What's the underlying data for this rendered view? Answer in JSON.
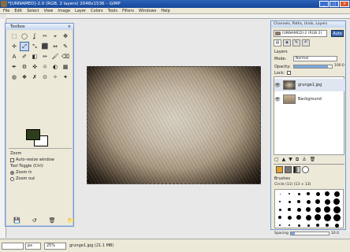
{
  "window": {
    "title": "*[UNNAMED]-2.0 (RGB, 2 layers) 2048x1536 – GIMP",
    "controls": [
      "_",
      "□",
      "×"
    ]
  },
  "menu": [
    "File",
    "Edit",
    "Select",
    "View",
    "Image",
    "Layer",
    "Colors",
    "Tools",
    "Filters",
    "Windows",
    "Help"
  ],
  "toolbox": {
    "title": "Toolbox",
    "tools": [
      "⬚",
      "◯",
      "ʆ",
      "✂",
      "⌖",
      "✥",
      "✛",
      "⤢",
      "⤡",
      "⬛",
      "⇔",
      "✎",
      "A",
      "✐",
      "◧",
      "✏",
      "🖌",
      "⌫",
      "✒",
      "⚙",
      "✜",
      "☼",
      "◐",
      "▦",
      "◍",
      "❖",
      "✗",
      "⊙",
      "✧",
      "✦"
    ],
    "active_tool_index": 7,
    "fg_color": "#2e3e1c",
    "bg_color": "#ffffff",
    "options": {
      "heading": "Zoom",
      "auto_resize": "Auto-resize window",
      "toggle_label": "Tool Toggle  (Ctrl)",
      "zoom_in": "Zoom in",
      "zoom_out": "Zoom out"
    },
    "bottom_icons": [
      "💾",
      "↺",
      "🗑",
      "📁"
    ]
  },
  "dock": {
    "title": "Channels, Paths, Undo, Layers",
    "image_select": "[UNNAMED]-2 (RGB 2)",
    "auto_label": "Auto",
    "layers": {
      "label": "Layers",
      "mode_label": "Mode:",
      "mode_value": "Normal",
      "opacity_label": "Opacity:",
      "opacity_value": "100.0",
      "lock_label": "Lock:",
      "items": [
        {
          "name": "grunge1.jpg",
          "selected": true
        },
        {
          "name": "Background",
          "selected": false
        }
      ]
    },
    "brushes": {
      "label": "Brushes",
      "current": "Circle (11) (13 × 13)",
      "spacing_label": "Spacing",
      "spacing_value": "10.0"
    }
  },
  "statusbar": {
    "coords": "",
    "unit": "px",
    "zoom": "25%",
    "file": "grunge1.jpg (21.1 MB)"
  }
}
